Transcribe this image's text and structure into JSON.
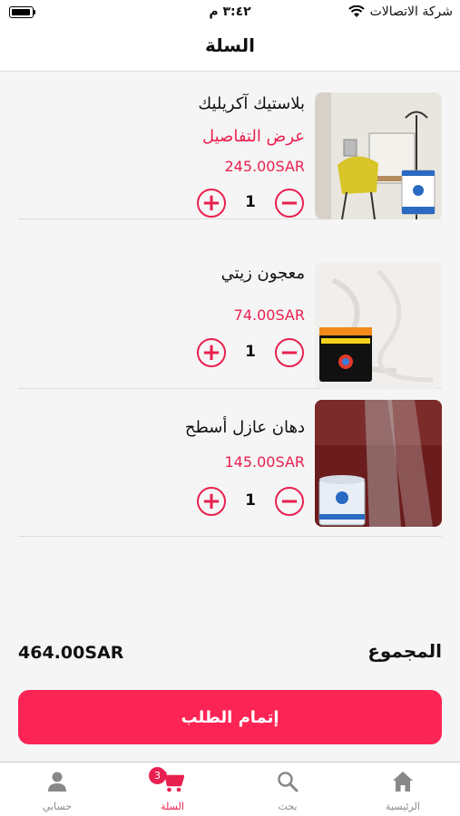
{
  "status_bar": {
    "carrier": "شركة الاتصالات",
    "time": "٣:٤٢ م"
  },
  "header": {
    "title": "السلة"
  },
  "cart": {
    "items": [
      {
        "name": "بلاستيك آكريليك",
        "details_label": "عرض التفاصيل",
        "price": "245.00SAR",
        "quantity": "1"
      },
      {
        "name": "معجون زيتي",
        "price": "74.00SAR",
        "quantity": "1"
      },
      {
        "name": "دهان عازل أسطح",
        "price": "145.00SAR",
        "quantity": "1"
      }
    ],
    "plus_symbol": "+",
    "minus_symbol": "−"
  },
  "total": {
    "label": "المجموع",
    "value": "464.00SAR"
  },
  "checkout": {
    "label": "إتمام الطلب"
  },
  "tabbar": {
    "tabs": [
      {
        "label": "حسابي",
        "icon": "person-icon"
      },
      {
        "label": "السلة",
        "icon": "cart-icon",
        "badge": "3"
      },
      {
        "label": "بحث",
        "icon": "search-icon"
      },
      {
        "label": "الرئيسية",
        "icon": "home-icon"
      }
    ]
  },
  "colors": {
    "accent": "#e8204f",
    "button": "#fc2454"
  }
}
